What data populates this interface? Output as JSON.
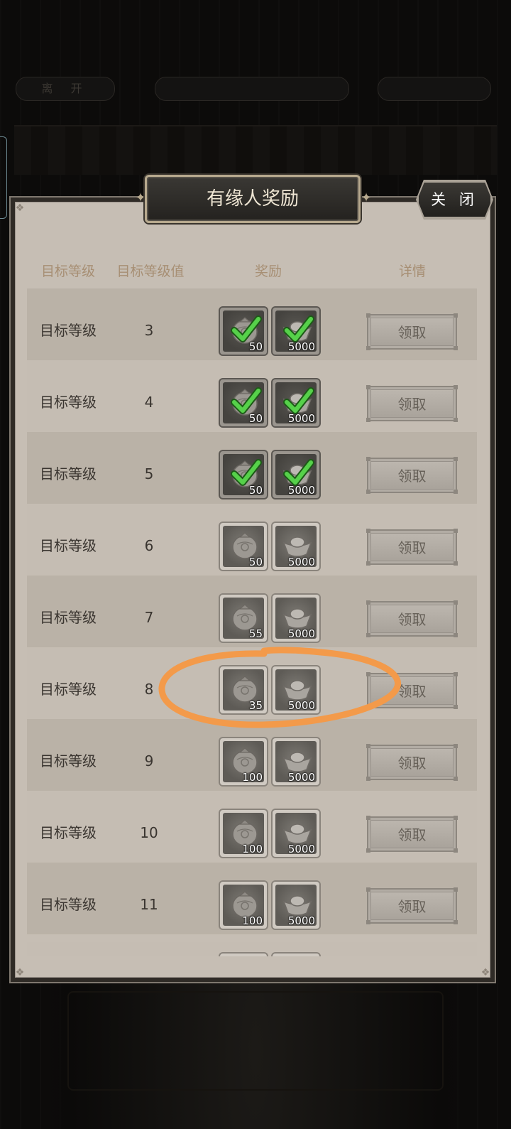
{
  "top_bar": {
    "leave_label": "离 开"
  },
  "dialog": {
    "title": "有缘人奖励",
    "close_label": "关 闭"
  },
  "table": {
    "headers": [
      "目标等级",
      "目标等级值",
      "奖励",
      "详情"
    ],
    "rows": [
      {
        "name": "目标等级",
        "level": "3",
        "reward1_qty": "50",
        "reward2_qty": "5000",
        "claimed": true,
        "button": "领取"
      },
      {
        "name": "目标等级",
        "level": "4",
        "reward1_qty": "50",
        "reward2_qty": "5000",
        "claimed": true,
        "button": "领取"
      },
      {
        "name": "目标等级",
        "level": "5",
        "reward1_qty": "50",
        "reward2_qty": "5000",
        "claimed": true,
        "button": "领取"
      },
      {
        "name": "目标等级",
        "level": "6",
        "reward1_qty": "50",
        "reward2_qty": "5000",
        "claimed": false,
        "button": "领取"
      },
      {
        "name": "目标等级",
        "level": "7",
        "reward1_qty": "55",
        "reward2_qty": "5000",
        "claimed": false,
        "button": "领取"
      },
      {
        "name": "目标等级",
        "level": "8",
        "reward1_qty": "35",
        "reward2_qty": "5000",
        "claimed": false,
        "button": "领取"
      },
      {
        "name": "目标等级",
        "level": "9",
        "reward1_qty": "100",
        "reward2_qty": "5000",
        "claimed": false,
        "button": "领取"
      },
      {
        "name": "目标等级",
        "level": "10",
        "reward1_qty": "100",
        "reward2_qty": "5000",
        "claimed": false,
        "button": "领取"
      },
      {
        "name": "目标等级",
        "level": "11",
        "reward1_qty": "100",
        "reward2_qty": "5000",
        "claimed": false,
        "button": "领取"
      }
    ]
  },
  "icons": {
    "reward1": "jade-pouch-icon",
    "reward2": "silver-ingot-icon",
    "claimed": "green-check-icon"
  },
  "colors": {
    "panel_bg": "#c6beb4",
    "header_text": "#a78f74",
    "check_green": "#56d14a",
    "annotation": "#f39a4a"
  }
}
